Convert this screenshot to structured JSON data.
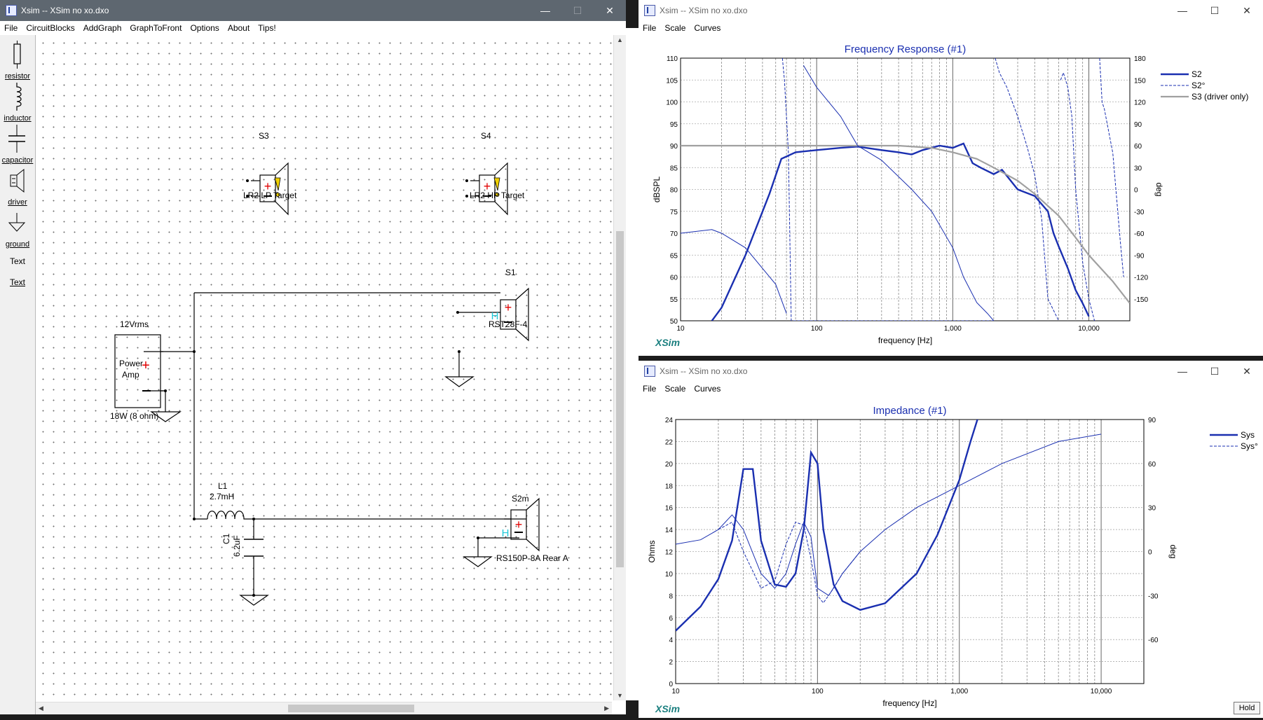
{
  "editor": {
    "title": "Xsim -- XSim no xo.dxo",
    "menu": [
      "File",
      "CircuitBlocks",
      "AddGraph",
      "GraphToFront",
      "Options",
      "About",
      "Tips!"
    ],
    "tools": [
      {
        "label": "resistor",
        "icon": "resistor-icon"
      },
      {
        "label": "inductor",
        "icon": "inductor-icon"
      },
      {
        "label": "capacitor",
        "icon": "capacitor-icon"
      },
      {
        "label": "driver",
        "icon": "driver-icon"
      },
      {
        "label": "ground",
        "icon": "ground-icon"
      },
      {
        "label": "Text",
        "icon": "text-tool"
      },
      {
        "label": "Text",
        "icon": "text-tool"
      }
    ],
    "circuit": {
      "amp_voltage": "12Vrms",
      "amp_name_line1": "Power",
      "amp_name_line2": "Amp",
      "amp_power": "18W (8 ohm)",
      "s3_name": "S3",
      "s3_label": "LR2 LP Target",
      "s4_name": "S4",
      "s4_label": "LR2 HP Target",
      "s1_name": "S1",
      "s1_label": "RST28F-4",
      "s2_name": "S2m",
      "s2_label": "RS150P-8A Rear A",
      "l1_name": "L1",
      "l1_value": "2.7mH",
      "c1_name": "C1",
      "c1_value": "6.2uF"
    }
  },
  "freq_window": {
    "title": "Xsim -- XSim no xo.dxo",
    "menu": [
      "File",
      "Scale",
      "Curves"
    ],
    "graph_title": "Frequency Response (#1)",
    "ylabel_left": "dBSPL",
    "ylabel_right": "deg",
    "xlabel": "frequency [Hz]",
    "brand": "XSim",
    "y_ticks": [
      "110",
      "105",
      "100",
      "95",
      "90",
      "85",
      "80",
      "75",
      "70",
      "65",
      "60",
      "55",
      "50"
    ],
    "y2_ticks": [
      "180",
      "150",
      "120",
      "90",
      "60",
      "30",
      "0",
      "-30",
      "-60",
      "-90",
      "-120",
      "-150"
    ],
    "x_ticks": [
      "10",
      "100",
      "1,000",
      "10,000"
    ],
    "legend": [
      "S2",
      "S2°",
      "S3 (driver only)"
    ]
  },
  "imp_window": {
    "title": "Xsim -- XSim no xo.dxo",
    "menu": [
      "File",
      "Scale",
      "Curves"
    ],
    "graph_title": "Impedance (#1)",
    "ylabel_left": "Ohms",
    "ylabel_right": "deg",
    "xlabel": "frequency [Hz]",
    "brand": "XSim",
    "y_ticks": [
      "24",
      "22",
      "20",
      "18",
      "16",
      "14",
      "12",
      "10",
      "8",
      "6",
      "4",
      "2",
      "0"
    ],
    "y2_ticks": [
      "90",
      "60",
      "30",
      "0",
      "-30",
      "-60"
    ],
    "x_ticks": [
      "10",
      "100",
      "1,000",
      "10,000"
    ],
    "legend": [
      "Sys",
      "Sys°"
    ],
    "hold_label": "Hold"
  },
  "colors": {
    "curve": "#1a2fb0",
    "grey_curve": "#a0a0a0",
    "title": "#1a2fb0",
    "brand": "#1a7f7f",
    "plus": "#e00000",
    "h_mark": "#20c8d8"
  },
  "chart_data": [
    {
      "type": "line",
      "title": "Frequency Response (#1)",
      "xlabel": "frequency [Hz]",
      "ylabel": "dBSPL",
      "y2label": "deg",
      "xscale": "log",
      "xlim": [
        10,
        20000
      ],
      "ylim": [
        50,
        110
      ],
      "y2lim": [
        -180,
        180
      ],
      "legend_position": "right",
      "series": [
        {
          "name": "S2",
          "axis": "left",
          "style": "solid-thick",
          "x": [
            17,
            20,
            30,
            45,
            55,
            70,
            100,
            150,
            200,
            300,
            400,
            500,
            600,
            800,
            1000,
            1200,
            1400,
            1600,
            2000,
            2300,
            3000,
            4000,
            5000,
            5500,
            6000,
            7000,
            8000,
            9000,
            10000
          ],
          "y": [
            50,
            53,
            65,
            79,
            87,
            88.5,
            89,
            89.5,
            89.8,
            89,
            88.5,
            88,
            89,
            90,
            89.5,
            90.5,
            86,
            85,
            83.5,
            84.5,
            80,
            78.5,
            75,
            70,
            67,
            62,
            57,
            54,
            51
          ]
        },
        {
          "name": "S2°",
          "axis": "right",
          "style": "dashed",
          "x": [
            55,
            56,
            58,
            60,
            62,
            65,
            2000,
            2050,
            2200,
            2500,
            3000,
            3500,
            4000,
            4500,
            5000,
            6000,
            6200,
            6500,
            7000,
            7500,
            8000,
            9000,
            10000,
            11000,
            12000,
            12500,
            13000,
            15000,
            17000,
            18000
          ],
          "y": [
            -180,
            180,
            150,
            100,
            50,
            -180,
            -180,
            180,
            160,
            140,
            100,
            60,
            20,
            -40,
            -150,
            -180,
            150,
            160,
            140,
            100,
            0,
            -100,
            -150,
            -180,
            180,
            120,
            110,
            50,
            -70,
            -120
          ]
        },
        {
          "name": "S3 (driver only)",
          "axis": "left",
          "style": "solid-grey",
          "x": [
            10,
            50,
            100,
            200,
            400,
            700,
            1000,
            1500,
            2000,
            3000,
            4000,
            6000,
            8000,
            10000,
            15000,
            20000
          ],
          "y": [
            90,
            90,
            90,
            90,
            90,
            89.5,
            88.5,
            87,
            85,
            82,
            79,
            74,
            69,
            65,
            59,
            54
          ]
        },
        {
          "name": "",
          "axis": "right",
          "style": "solid-thin",
          "x": [
            10,
            17,
            20,
            30,
            50,
            60,
            80,
            100,
            150,
            200,
            300,
            500,
            700,
            1000,
            1200,
            1500,
            1800,
            2000
          ],
          "y": [
            -60,
            -55,
            -60,
            -80,
            -130,
            -170,
            170,
            140,
            100,
            60,
            40,
            0,
            -30,
            -80,
            -120,
            -155,
            -170,
            -180
          ]
        }
      ]
    },
    {
      "type": "line",
      "title": "Impedance (#1)",
      "xlabel": "frequency [Hz]",
      "ylabel": "Ohms",
      "y2label": "deg",
      "xscale": "log",
      "xlim": [
        10,
        20000
      ],
      "ylim": [
        0,
        24
      ],
      "y2lim": [
        -90,
        90
      ],
      "legend_position": "right",
      "series": [
        {
          "name": "Sys",
          "axis": "left",
          "style": "solid-thick",
          "x": [
            10,
            15,
            20,
            25,
            30,
            35,
            40,
            50,
            60,
            70,
            80,
            90,
            100,
            110,
            130,
            150,
            200,
            300,
            500,
            700,
            1000,
            1200,
            1500
          ],
          "y": [
            4.8,
            7,
            9.5,
            13,
            19.5,
            19.5,
            13,
            9,
            8.8,
            10,
            14,
            21,
            20,
            14,
            9,
            7.5,
            6.7,
            7.3,
            10,
            13.5,
            18.5,
            22,
            26
          ]
        },
        {
          "name": "Sys°",
          "axis": "right",
          "style": "dashed",
          "x": [
            20,
            25,
            30,
            40,
            50,
            60,
            70,
            80,
            90,
            100,
            110,
            130,
            150,
            200
          ],
          "y": [
            15,
            20,
            0,
            -25,
            -20,
            5,
            20,
            18,
            -5,
            -30,
            -35,
            -25,
            -15,
            0
          ]
        },
        {
          "name": "",
          "axis": "right",
          "style": "solid-thin",
          "x": [
            10,
            15,
            20,
            25,
            30,
            40,
            50,
            60,
            70,
            80,
            90,
            100,
            120,
            150,
            200,
            300,
            500,
            1000,
            2000,
            5000,
            10000
          ],
          "y": [
            5,
            8,
            15,
            25,
            15,
            -15,
            -25,
            -15,
            5,
            20,
            10,
            -25,
            -30,
            -15,
            0,
            15,
            30,
            45,
            60,
            75,
            80
          ]
        }
      ]
    }
  ]
}
